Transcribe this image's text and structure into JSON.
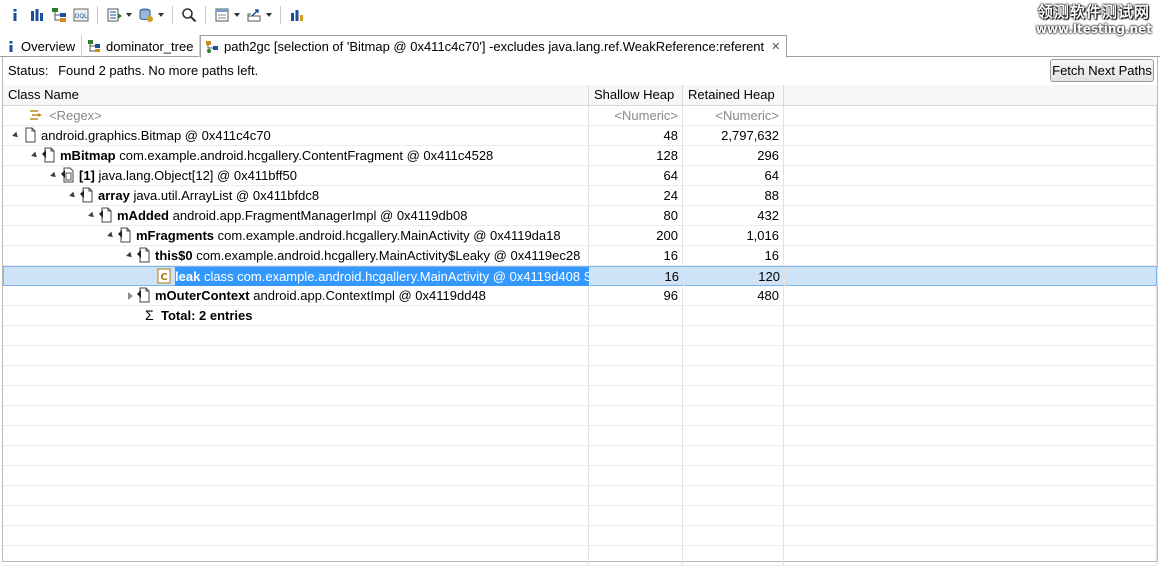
{
  "watermark": {
    "line1": "领测软件测试网",
    "line2": "www.ltesting.net"
  },
  "toolbar": {
    "icons": [
      "info-icon",
      "histogram-icon",
      "dominator-tree-icon",
      "oql-icon",
      "query-browser-icon",
      "heap-dump-overview-icon",
      "search-icon",
      "group-result-icon",
      "export-icon",
      "leak-suspects-icon"
    ]
  },
  "tabs": [
    {
      "label": "Overview"
    },
    {
      "label": "dominator_tree"
    },
    {
      "label": "path2gc [selection of 'Bitmap @ 0x411c4c70'] -excludes java.lang.ref.WeakReference:referent"
    }
  ],
  "status": {
    "label": "Status:",
    "text": "Found 2 paths. No more paths left."
  },
  "fetch_button": {
    "label": "Fetch Next Paths"
  },
  "columns": [
    "Class Name",
    "Shallow Heap",
    "Retained Heap"
  ],
  "filter_row": {
    "name": "<Regex>",
    "shallow": "<Numeric>",
    "retained": "<Numeric>"
  },
  "rows": [
    {
      "field": "",
      "obj": "android.graphics.Bitmap @ 0x411c4c70",
      "shallow": "48",
      "retained": "2,797,632",
      "level": 0,
      "state": "expanded"
    },
    {
      "field": "mBitmap",
      "obj": "com.example.android.hcgallery.ContentFragment @ 0x411c4528",
      "shallow": "128",
      "retained": "296",
      "level": 1,
      "state": "expanded"
    },
    {
      "field": "[1]",
      "obj": "java.lang.Object[12] @ 0x411bff50",
      "shallow": "64",
      "retained": "64",
      "level": 2,
      "state": "expanded"
    },
    {
      "field": "array",
      "obj": "java.util.ArrayList @ 0x411bfdc8",
      "shallow": "24",
      "retained": "88",
      "level": 3,
      "state": "expanded"
    },
    {
      "field": "mAdded",
      "obj": "android.app.FragmentManagerImpl @ 0x4119db08",
      "shallow": "80",
      "retained": "432",
      "level": 4,
      "state": "expanded"
    },
    {
      "field": "mFragments",
      "obj": "com.example.android.hcgallery.MainActivity @ 0x4119da18",
      "shallow": "200",
      "retained": "1,016",
      "level": 5,
      "state": "expanded"
    },
    {
      "field": "this$0",
      "obj": "com.example.android.hcgallery.MainActivity$Leaky @ 0x4119ec28",
      "shallow": "16",
      "retained": "16",
      "level": 6,
      "state": "expanded"
    },
    {
      "field": "leak",
      "obj": "class com.example.android.hcgallery.MainActivity @ 0x4119d408 S",
      "shallow": "16",
      "retained": "120",
      "level": 7,
      "state": "leaf",
      "selected": true
    },
    {
      "field": "mOuterContext",
      "obj": "android.app.ContextImpl @ 0x4119dd48",
      "shallow": "96",
      "retained": "480",
      "level": 6,
      "state": "collapsed"
    }
  ],
  "total": {
    "symbol": "Σ",
    "text": "Total: 2 entries"
  }
}
